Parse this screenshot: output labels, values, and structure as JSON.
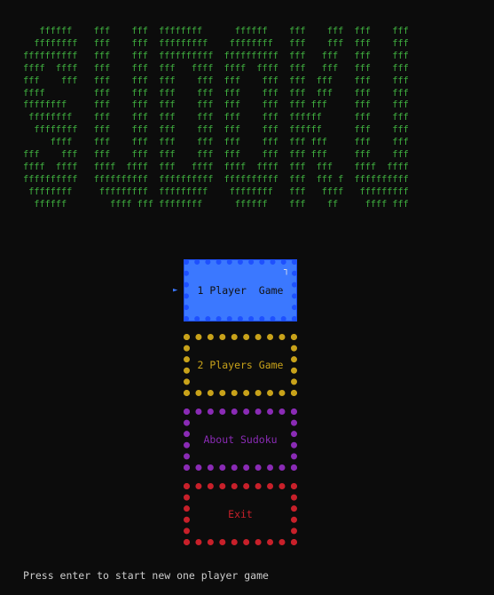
{
  "logo": {
    "art": "   ffffff    fff    fff  ffffffff      ffffff    fff    fff  fff    fff\n  ffffffff   fff    fff  fffffffff    ffffffff   fff    fff  fff    fff\nffffffffff   fff    fff  ffffffffff  ffffffffff  fff   fff   fff    fff\nffff  ffff   fff    fff  fff   ffff  ffff  ffff  fff   fff   fff    fff\nfff    fff   fff    fff  fff    fff  fff    fff  fff  fff    fff    fff\nffff         fff    fff  fff    fff  fff    fff  fff  fff    fff    fff\nffffffff     fff    fff  fff    fff  fff    fff  fff fff     fff    fff\n ffffffff    fff    fff  fff    fff  fff    fff  ffffff      fff    fff\n  ffffffff   fff    fff  fff    fff  fff    fff  ffffff      fff    fff\n     ffff    fff    fff  fff    fff  fff    fff  fff fff     fff    fff\nfff    fff   fff    fff  fff    fff  fff    fff  fff fff     fff    fff\nffff  ffff   ffff  ffff  fff   ffff  ffff  ffff  fff  fff    ffff  ffff\nffffffffff   ffffffffff  ffffffffff  ffffffffff  fff  fff f  ffffffffff\n ffffffff     fffffffff  fffffffff    ffffffff   fff   ffff   fffffffff\n  ffffff        ffff fff ffffffff      ffffff    fff    ff     ffff fff",
    "color": "#3fae3f"
  },
  "menu": {
    "pointer": "►",
    "selected_mark": "┐",
    "items": [
      {
        "label": "1 Player  Game",
        "color": "#3b78ff"
      },
      {
        "label": "2 Players Game",
        "color": "#c8a21a"
      },
      {
        "label": "About Sudoku",
        "color": "#8a2bb5"
      },
      {
        "label": "Exit",
        "color": "#c8202a"
      }
    ]
  },
  "status": {
    "text": "Press enter to start new one player game"
  }
}
